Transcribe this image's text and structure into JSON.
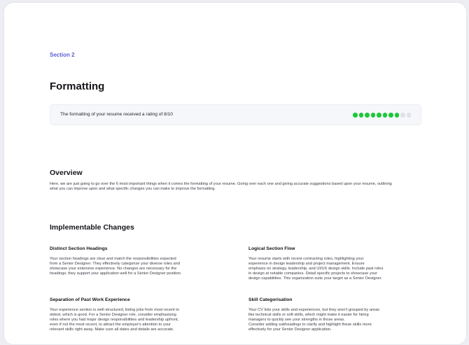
{
  "section": {
    "tag": "Section 2",
    "title": "Formatting"
  },
  "rating": {
    "text": "The formatting of your resume received a rating of 8/10",
    "score": 8,
    "max": 10,
    "on_color": "#1ac938",
    "off_color": "#dfe1e6"
  },
  "overview": {
    "heading": "Overview",
    "text": "Here, we are just going to go over the 6 most important things when it comes the formatting of your resume. Going over each one and giving accurate suggestions based upon your resume, outlining what you can improve upon and what specific changes you can make to improve the formatting."
  },
  "changes": {
    "heading": "Implementable Changes",
    "items": [
      {
        "title": "Distinct Section Headings",
        "text": "Your section headings are clear and match the responsibilities expected\nfrom a Senior Designer. They effectively categorize your diverse roles and\nshowcase your extensive experience. No changes are necessary for the\nheadings; they support your application well for a Senior Designer position."
      },
      {
        "title": "Logical Section Flow",
        "text": "Your resume starts with recent contracting roles, highlighting your\nexperience in design leadership and project management. Ensure\nemphasis on strategy, leadership, and UI/UX design skills. Include past roles\nin design at notable companies. Detail specific projects to showcase your\ndesign capabilities. This organization suits your target as a Senior Designer."
      },
      {
        "title": "Separation of Past Work Experience",
        "text": "Your experience section is well-structured, listing jobs from most recent to\noldest, which is good. For a Senior Designer role, consider emphasising\nroles where you had major design responsibilities and leadership upfront,\neven if not the most recent, to attract the employer's attention to your\nrelevant skills right away. Make sure all dates and details are accurate."
      },
      {
        "title": "Skill Categorisation",
        "text": "Your CV lists your skills and experiences, but they aren't grouped by areas\nlike technical skills or soft skills, which might make it easier for hiring\nmanagers to quickly see your strengths in those areas.\nConsider adding subheadings to clarify and highlight these skills more\neffectively for your Senior Designer application."
      }
    ]
  }
}
